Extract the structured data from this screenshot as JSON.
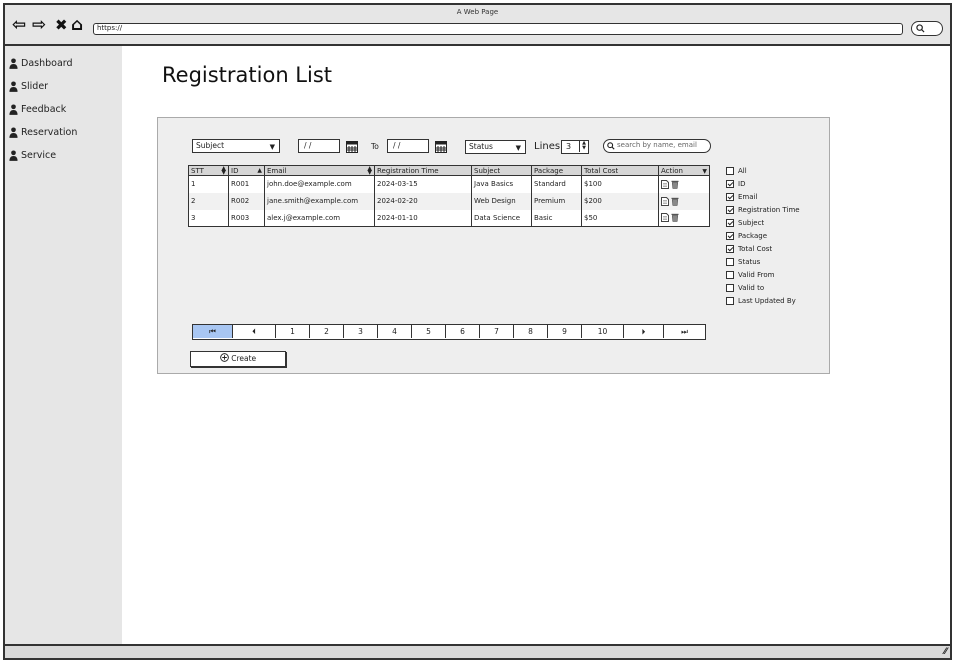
{
  "browser": {
    "title": "A Web Page",
    "url": "https://"
  },
  "sidebar": {
    "items": [
      {
        "label": "Dashboard",
        "icon": "person-icon"
      },
      {
        "label": "Slider",
        "icon": "person-icon"
      },
      {
        "label": "Feedback",
        "icon": "person-icon"
      },
      {
        "label": "Reservation",
        "icon": "person-icon"
      },
      {
        "label": "Service",
        "icon": "person-icon"
      }
    ]
  },
  "page": {
    "title": "Registration List"
  },
  "filters": {
    "subject": "Subject",
    "date_from": "/ /",
    "to_label": "To",
    "date_to": "/ /",
    "status": "Status",
    "lines_label": "Lines",
    "lines_value": "3",
    "search_placeholder": "search by name, email"
  },
  "table": {
    "headers": [
      "STT",
      "ID",
      "Email",
      "Registration Time",
      "Subject",
      "Package",
      "Total Cost",
      "Action"
    ],
    "rows": [
      [
        "1",
        "R001",
        "john.doe@example.com",
        "2024-03-15",
        "Java Basics",
        "Standard",
        "$100"
      ],
      [
        "2",
        "R002",
        "jane.smith@example.com",
        "2024-02-20",
        "Web Design",
        "Premium",
        "$200"
      ],
      [
        "3",
        "R003",
        "alex.j@example.com",
        "2024-01-10",
        "Data Science",
        "Basic",
        "$50"
      ]
    ]
  },
  "columns": [
    {
      "label": "All",
      "checked": false
    },
    {
      "label": "ID",
      "checked": true
    },
    {
      "label": "Email",
      "checked": true
    },
    {
      "label": "Registration Time",
      "checked": true
    },
    {
      "label": "Subject",
      "checked": true
    },
    {
      "label": "Package",
      "checked": true
    },
    {
      "label": "Total Cost",
      "checked": true
    },
    {
      "label": "Status",
      "checked": false
    },
    {
      "label": "Valid From",
      "checked": false
    },
    {
      "label": "Valid to",
      "checked": false
    },
    {
      "label": "Last Updated By",
      "checked": false
    }
  ],
  "pagination": {
    "first": "⏮",
    "prev": "⏴",
    "pages": [
      "1",
      "2",
      "3",
      "4",
      "5",
      "6",
      "7",
      "8",
      "9",
      "10"
    ],
    "next": "⏵",
    "last": "⏭",
    "active": "first"
  },
  "create_label": "Create",
  "colors": {
    "sidebar_bg": "#e6e6e6",
    "panel_bg": "#eeeeee",
    "active_page": "#a8c6f2"
  }
}
